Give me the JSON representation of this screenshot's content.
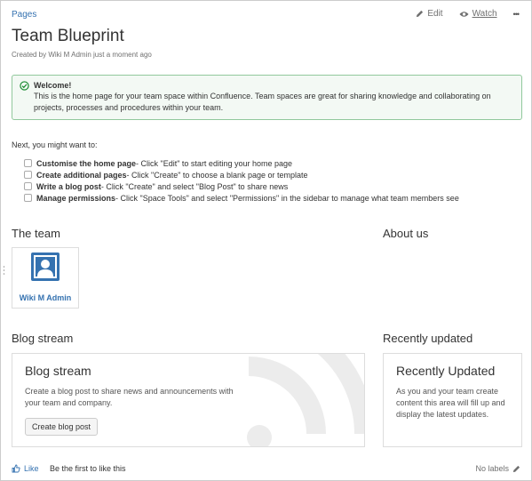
{
  "breadcrumb": "Pages",
  "actions": {
    "edit": "Edit",
    "watch": "Watch",
    "more": "•••"
  },
  "page_title": "Team Blueprint",
  "byline": "Created by Wiki M Admin just a moment ago",
  "welcome": {
    "title": "Welcome!",
    "body": "This is the home page for your team space within Confluence. Team spaces are great for sharing knowledge and collaborating on projects, processes and procedures within your team."
  },
  "next_intro": "Next, you might want to:",
  "tasks": [
    {
      "bold": "Customise the home page",
      "rest": " - Click \"Edit\" to start editing your home page"
    },
    {
      "bold": "Create additional pages",
      "rest": " - Click \"Create\" to choose a blank page or template"
    },
    {
      "bold": "Write a blog post",
      "rest": " - Click \"Create\" and select \"Blog Post\" to share news"
    },
    {
      "bold": "Manage permissions",
      "rest": " - Click \"Space Tools\" and select \"Permissions\" in the sidebar to manage what team members see"
    }
  ],
  "team": {
    "heading": "The team",
    "member_name": "Wiki M Admin"
  },
  "about": {
    "heading": "About us"
  },
  "blog": {
    "heading": "Blog stream",
    "card_title": "Blog stream",
    "card_body": "Create a blog post to share news and announcements with your team and company.",
    "button": "Create blog post"
  },
  "recent": {
    "heading": "Recently updated",
    "card_title": "Recently Updated",
    "card_body": "As you and your team create content this area will fill up and display the latest updates."
  },
  "footer": {
    "like": "Like",
    "first_like": "Be the first to like this",
    "no_labels": "No labels"
  },
  "colors": {
    "link": "#3572b0",
    "success_border": "#91c89c",
    "success_bg": "#f3f9f4",
    "success_icon": "#14892c"
  }
}
